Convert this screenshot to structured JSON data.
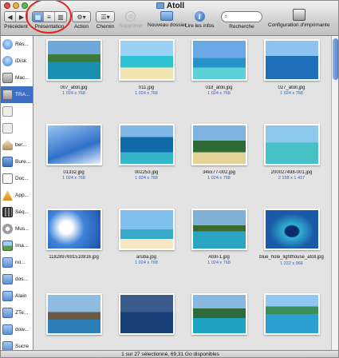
{
  "window": {
    "title": "Atoll"
  },
  "toolbar": {
    "back_label": "Précédent",
    "view_label": "Présentation",
    "action_label": "Action",
    "path_label": "Chemin",
    "delete_label": "Supprimer",
    "new_folder_label": "Nouveau dossier",
    "info_label": "Lire les infos",
    "search_label": "Recherche",
    "print_label": "Configuration d'imprimante"
  },
  "sidebar": {
    "items": [
      {
        "label": "Rés...",
        "icon": "network-icon"
      },
      {
        "label": "iDisk",
        "icon": "idisk-icon"
      },
      {
        "label": "Mac...",
        "icon": "harddisk-icon"
      },
      {
        "label": "TRA...",
        "icon": "harddisk-icon",
        "selected": true
      },
      {
        "label": "",
        "icon": "drive-icon"
      },
      {
        "label": "",
        "icon": "drive-icon"
      },
      {
        "label": "ber...",
        "icon": "home-icon"
      },
      {
        "label": "Bure...",
        "icon": "desktop-icon"
      },
      {
        "label": "Doc...",
        "icon": "documents-icon"
      },
      {
        "label": "App...",
        "icon": "applications-icon"
      },
      {
        "label": "Séq...",
        "icon": "movies-icon"
      },
      {
        "label": "Mus...",
        "icon": "music-icon"
      },
      {
        "label": "Ima...",
        "icon": "pictures-icon"
      },
      {
        "label": "no...",
        "icon": "folder-icon"
      },
      {
        "label": "dos...",
        "icon": "folder-icon"
      },
      {
        "label": "Alain",
        "icon": "folder-icon"
      },
      {
        "label": "ZTe...",
        "icon": "folder-icon"
      },
      {
        "label": "dow...",
        "icon": "folder-icon"
      },
      {
        "label": "Sucre",
        "icon": "folder-icon"
      }
    ]
  },
  "files": [
    {
      "name": "007_atoll.jpg",
      "dims": "1 024 x 768"
    },
    {
      "name": "011.jpg",
      "dims": "1 024 x 768"
    },
    {
      "name": "018_atoll.jpg",
      "dims": "1 024 x 768"
    },
    {
      "name": "027_atoll.jpg",
      "dims": "1 024 x 768"
    },
    {
      "name": "01332.jpg",
      "dims": "1 024 x 768"
    },
    {
      "name": "002253.jpg",
      "dims": "1 024 x 768"
    },
    {
      "name": "34xx77-002.jpg",
      "dims": "1 024 x 768"
    },
    {
      "name": "200027498-001.jpg",
      "dims": "2 158 x 1 437"
    },
    {
      "name": "1182897691510816.jpg",
      "dims": ""
    },
    {
      "name": "aruba.jpg",
      "dims": "1 024 x 768"
    },
    {
      "name": "Atoll-1.jpg",
      "dims": "1 024 x 768"
    },
    {
      "name": "blue_hole_lighthouse_atoll.jpg",
      "dims": "1 222 x 966"
    },
    {
      "name": "",
      "dims": ""
    },
    {
      "name": "",
      "dims": ""
    },
    {
      "name": "",
      "dims": ""
    },
    {
      "name": "",
      "dims": ""
    }
  ],
  "status": {
    "text": "1 sur 27 sélectionné, 69,31 Go disponibles"
  },
  "colors": {
    "selection": "#3d6fc7",
    "annotation": "#e3241b",
    "dims_text": "#2f63b8"
  }
}
